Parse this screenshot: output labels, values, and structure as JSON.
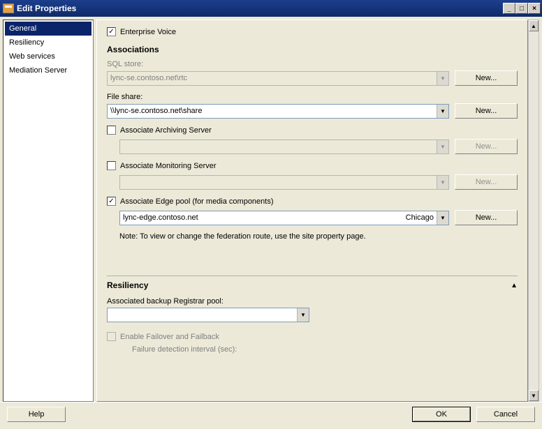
{
  "title": "Edit Properties",
  "sidebar": {
    "items": [
      {
        "label": "General",
        "selected": true
      },
      {
        "label": "Resiliency",
        "selected": false
      },
      {
        "label": "Web services",
        "selected": false
      },
      {
        "label": "Mediation Server",
        "selected": false
      }
    ]
  },
  "main": {
    "enterprise_voice": {
      "label": "Enterprise Voice",
      "checked": true
    },
    "associations": {
      "heading": "Associations",
      "sql_store": {
        "label": "SQL store:",
        "value": "lync-se.contoso.net\\rtc",
        "new": "New...",
        "enabled": false
      },
      "file_share": {
        "label": "File share:",
        "value": "\\\\lync-se.contoso.net\\share",
        "new": "New...",
        "enabled": true
      },
      "archiving": {
        "label": "Associate Archiving Server",
        "checked": false,
        "value": "",
        "new": "New..."
      },
      "monitoring": {
        "label": "Associate Monitoring Server",
        "checked": false,
        "value": "",
        "new": "New..."
      },
      "edge": {
        "label": "Associate Edge pool (for media components)",
        "checked": true,
        "value": "lync-edge.contoso.net",
        "region": "Chicago",
        "new": "New...",
        "note": "Note: To view or change the federation route, use the site property page."
      }
    },
    "resiliency": {
      "heading": "Resiliency",
      "backup_label": "Associated backup Registrar pool:",
      "backup_value": "",
      "failover": {
        "label": "Enable Failover and Failback",
        "checked": false,
        "enabled": false
      },
      "detection_label": "Failure detection interval (sec):"
    }
  },
  "footer": {
    "help": "Help",
    "ok": "OK",
    "cancel": "Cancel"
  }
}
